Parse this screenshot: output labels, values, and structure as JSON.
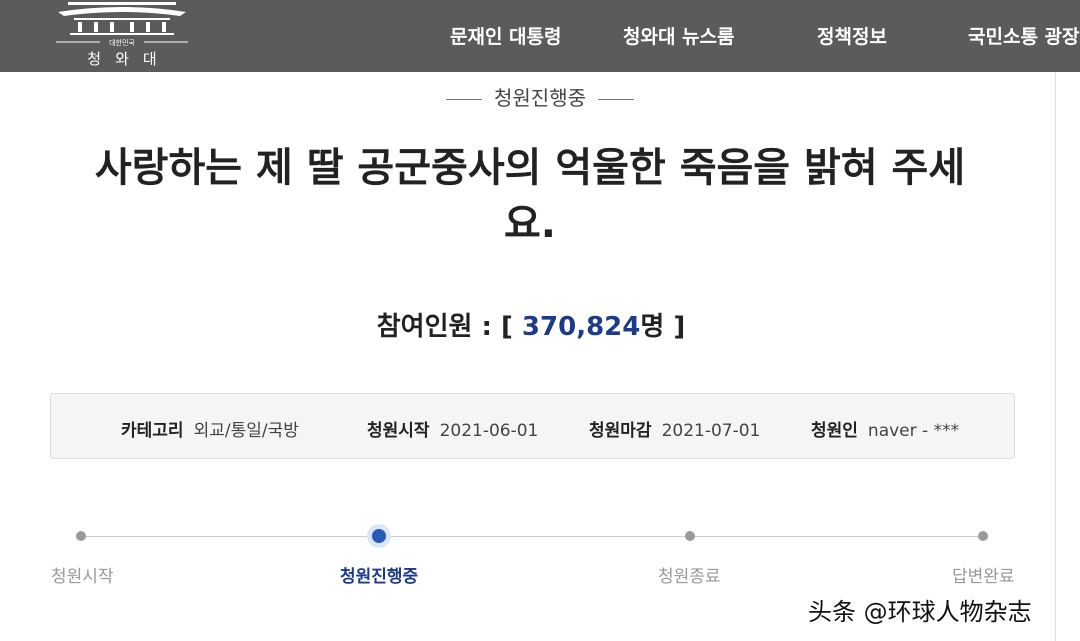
{
  "header": {
    "logo_small_text": "대한민국",
    "logo_text": "청와대",
    "nav": [
      "문재인 대통령",
      "청와대 뉴스룸",
      "정책정보",
      "국민소통 광장"
    ]
  },
  "petition": {
    "status": "청원진행중",
    "title": "사랑하는 제 딸 공군중사의 억울한 죽음을 밝혀 주세요.",
    "count_label": "참여인원 :",
    "count_open": "[",
    "count_value": "370,824",
    "count_unit": "명",
    "count_close": "]"
  },
  "info": [
    {
      "key": "카테고리",
      "value": "외교/통일/국방"
    },
    {
      "key": "청원시작",
      "value": "2021-06-01"
    },
    {
      "key": "청원마감",
      "value": "2021-07-01"
    },
    {
      "key": "청원인",
      "value": "naver - ***"
    }
  ],
  "progress": {
    "steps": [
      "청원시작",
      "청원진행중",
      "청원종료",
      "답변완료"
    ],
    "current_step": "청원진행중"
  },
  "watermark": "头条 @环球人物杂志",
  "colors": {
    "header_bg": "#5b5b5b",
    "accent": "#1d3b8c",
    "active_dot": "#2a5ab8"
  }
}
